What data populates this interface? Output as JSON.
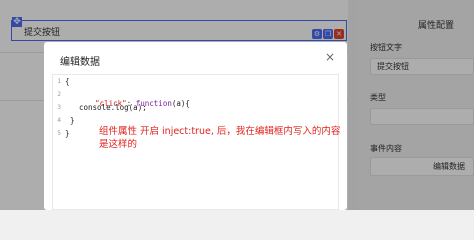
{
  "canvas": {
    "button_text": "提交按钮",
    "move_glyph": "✥",
    "tool_icons": [
      "settings-icon",
      "copy-icon",
      "delete-icon"
    ],
    "colors": {
      "select": "#4a6cf7",
      "delete": "#e0452f"
    }
  },
  "panel": {
    "title": "属性配置",
    "button_text_label": "按钮文字",
    "button_text_value": "提交按钮",
    "type_label": "类型",
    "event_label": "事件内容",
    "edit_data_button": "编辑数据"
  },
  "modal": {
    "title": "编辑数据",
    "close_glyph": "×",
    "line_numbers": [
      "1",
      "2",
      "3",
      "4",
      "5"
    ],
    "code": {
      "l1": "{",
      "l2_key": "\"click\"",
      "l2_colon": ": ",
      "l2_kw": "function",
      "l2_rest": "(a){",
      "l3": "console.log(a);",
      "l4": "}",
      "l5": "}"
    },
    "annotation": "组件属性 开启 inject:true, 后，我在编辑框内写入的内容是这样的"
  }
}
